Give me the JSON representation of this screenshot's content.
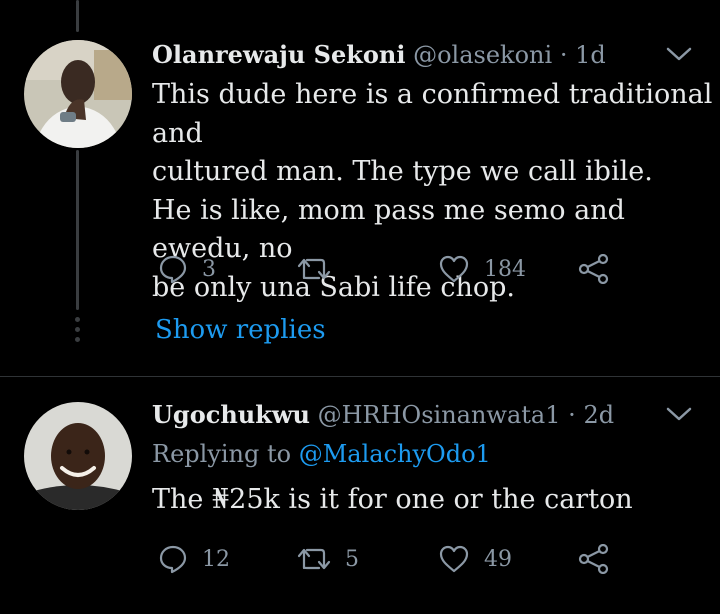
{
  "tweets": [
    {
      "name": "Olanrewaju Sekoni",
      "handle": "@olasekoni",
      "separator": "·",
      "time": "1d",
      "lines": [
        "This dude here is a confirmed traditional and",
        "cultured man. The type we call ibile.",
        "He is like, mom pass me semo and ewedu, no",
        "be only una Sabi life chop."
      ],
      "replies": "3",
      "retweets": "",
      "likes": "184",
      "show_replies": "Show replies"
    },
    {
      "name": "Ugochukwu",
      "handle": "@HRHOsinanwata1",
      "separator": "·",
      "time": "2d",
      "replying_prefix": "Replying to",
      "replying_to": "@MalachyOdo1",
      "lines": [
        "The ₦25k is it for one or the carton"
      ],
      "replies": "12",
      "retweets": "5",
      "likes": "49"
    }
  ],
  "icons": {
    "reply": "reply-icon",
    "retweet": "retweet-icon",
    "like": "heart-icon",
    "share": "share-icon",
    "more": "chevron-down-icon"
  },
  "colors": {
    "background": "#000000",
    "text": "#e7e9ea",
    "muted": "#8b98a5",
    "link": "#1d9bf0",
    "line": "#3a3d40"
  }
}
